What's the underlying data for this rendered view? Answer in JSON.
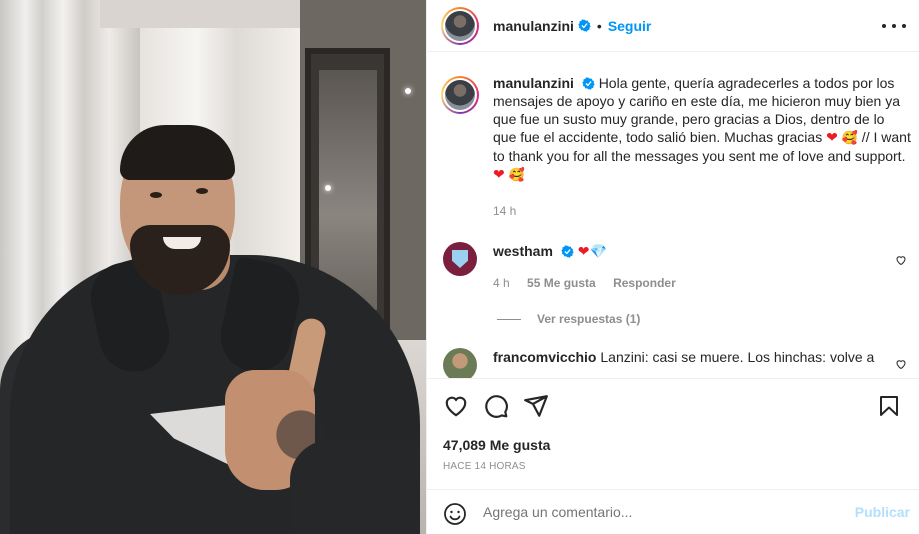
{
  "post": {
    "username": "manulanzini",
    "separator": "•",
    "follow_label": "Seguir",
    "caption_username": "manulanzini",
    "caption_part1": "Hola gente, quería agradecerles a todos por los mensajes de apoyo y cariño en este día, me hicieron muy bien ya que fue un susto muy grande, pero gracias a Dios, dentro de lo que fue el accidente, todo salió bien. Muchas gracias ",
    "caption_part2": " // I want to thank you for all the messages you sent me of love and support. ",
    "caption_time": "14 h"
  },
  "comments": [
    {
      "username": "westham",
      "text": "",
      "time": "4 h",
      "likes": "55 Me gusta",
      "reply_label": "Responder",
      "view_replies": "Ver respuestas (1)"
    },
    {
      "username": "francomvicchio",
      "text": "Lanzini: casi se muere. Los hinchas: volve a"
    }
  ],
  "actions": {
    "likes_count": "47,089 Me gusta",
    "posted_ago": "HACE 14 HORAS",
    "comment_placeholder": "Agrega un comentario...",
    "publish_label": "Publicar"
  },
  "colors": {
    "accent": "#0095f6",
    "heart": "#ed1c24",
    "muted": "#8e8e8e",
    "publish_disabled": "#b2dffc"
  }
}
